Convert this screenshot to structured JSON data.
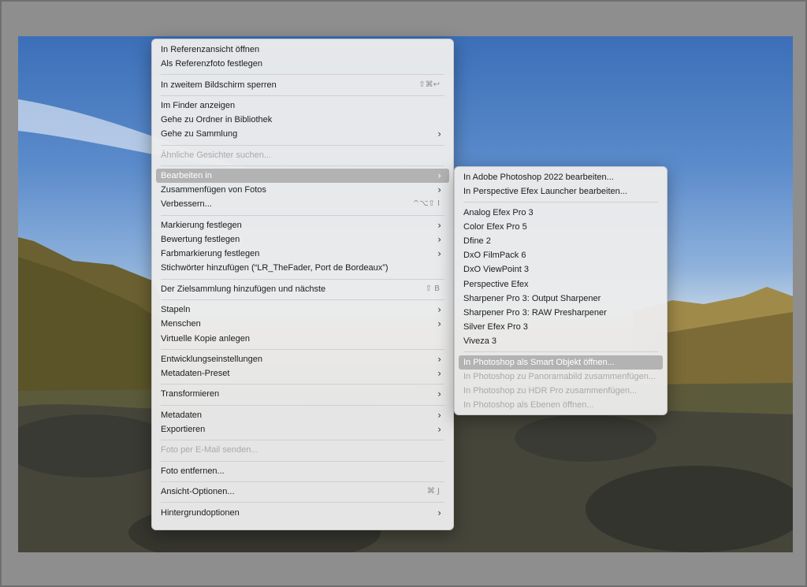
{
  "main_menu": {
    "groups": [
      [
        {
          "label": "In Referenzansicht öffnen"
        },
        {
          "label": "Als Referenzfoto festlegen"
        }
      ],
      [
        {
          "label": "In zweitem Bildschirm sperren",
          "shortcut": "⇧⌘↩"
        }
      ],
      [
        {
          "label": "Im Finder anzeigen"
        },
        {
          "label": "Gehe zu Ordner in Bibliothek"
        },
        {
          "label": "Gehe zu Sammlung",
          "submenu": true
        }
      ],
      [
        {
          "label": "Ähnliche Gesichter suchen...",
          "disabled": true
        }
      ],
      [
        {
          "label": "Bearbeiten in",
          "submenu": true,
          "highlighted": true
        },
        {
          "label": "Zusammenfügen von Fotos",
          "submenu": true
        },
        {
          "label": "Verbessern...",
          "shortcut": "^⌥⇧ I"
        }
      ],
      [
        {
          "label": "Markierung festlegen",
          "submenu": true
        },
        {
          "label": "Bewertung festlegen",
          "submenu": true
        },
        {
          "label": "Farbmarkierung festlegen",
          "submenu": true
        },
        {
          "label": "Stichwörter hinzufügen (“LR_TheFader, Port de Bordeaux”)"
        }
      ],
      [
        {
          "label": "Der Zielsammlung hinzufügen und nächste",
          "shortcut": "⇧ B"
        }
      ],
      [
        {
          "label": "Stapeln",
          "submenu": true
        },
        {
          "label": "Menschen",
          "submenu": true
        },
        {
          "label": "Virtuelle Kopie anlegen"
        }
      ],
      [
        {
          "label": "Entwicklungseinstellungen",
          "submenu": true
        },
        {
          "label": "Metadaten-Preset",
          "submenu": true
        }
      ],
      [
        {
          "label": "Transformieren",
          "submenu": true
        }
      ],
      [
        {
          "label": "Metadaten",
          "submenu": true
        },
        {
          "label": "Exportieren",
          "submenu": true
        }
      ],
      [
        {
          "label": "Foto per E-Mail senden...",
          "disabled": true
        }
      ],
      [
        {
          "label": "Foto entfernen..."
        }
      ],
      [
        {
          "label": "Ansicht-Optionen...",
          "shortcut": "⌘ J"
        }
      ],
      [
        {
          "label": "Hintergrundoptionen",
          "submenu": true
        }
      ]
    ]
  },
  "sub_menu": {
    "groups": [
      [
        {
          "label": "In Adobe Photoshop 2022 bearbeiten..."
        },
        {
          "label": "In Perspective Efex Launcher bearbeiten..."
        }
      ],
      [
        {
          "label": "Analog Efex Pro 3"
        },
        {
          "label": "Color Efex Pro 5"
        },
        {
          "label": "Dfine 2"
        },
        {
          "label": "DxO FilmPack 6"
        },
        {
          "label": "DxO ViewPoint 3"
        },
        {
          "label": "Perspective Efex"
        },
        {
          "label": "Sharpener Pro 3: Output Sharpener"
        },
        {
          "label": "Sharpener Pro 3: RAW Presharpener"
        },
        {
          "label": "Silver Efex Pro 3"
        },
        {
          "label": "Viveza 3"
        }
      ],
      [
        {
          "label": "In Photoshop als Smart Objekt öffnen...",
          "highlighted": true
        },
        {
          "label": "In Photoshop zu Panoramabild zusammenfügen...",
          "disabled": true
        },
        {
          "label": "In Photoshop zu HDR Pro zusammenfügen...",
          "disabled": true
        },
        {
          "label": "In Photoshop als Ebenen öffnen...",
          "disabled": true
        }
      ]
    ]
  },
  "icons": {
    "submenu_arrow": "›"
  }
}
